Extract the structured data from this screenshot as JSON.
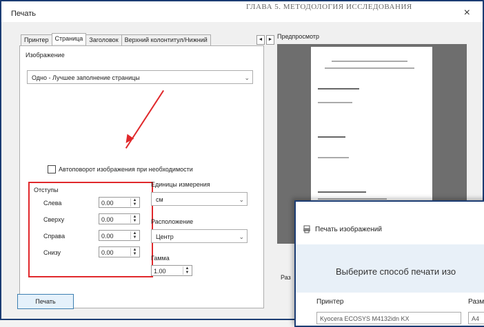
{
  "window": {
    "title": "Печать",
    "close": "×"
  },
  "background_text": "ГЛАВА 5. МЕТОДОЛОГИЯ ИССЛЕДОВАНИЯ",
  "tabs": [
    "Принтер",
    "Страница",
    "Заголовок",
    "Верхний колонтитул/Нижний"
  ],
  "image_section": {
    "label": "Изображение",
    "selected": "Одно - Лучшее заполнение страницы"
  },
  "autorotate": "Автоповорот изображения при необходимости",
  "margins": {
    "label": "Отступы",
    "rows": [
      {
        "label": "Слева",
        "value": "0.00"
      },
      {
        "label": "Сверху",
        "value": "0.00"
      },
      {
        "label": "Справа",
        "value": "0.00"
      },
      {
        "label": "Снизу",
        "value": "0.00"
      }
    ]
  },
  "units": {
    "label": "Единицы измерения",
    "selected": "см"
  },
  "placement": {
    "label": "Расположение",
    "selected": "Центр"
  },
  "gamma": {
    "label": "Гамма",
    "value": "1.00"
  },
  "print_button": "Печать",
  "preview_label": "Предпросмотр",
  "side_bottom_text": "Раз",
  "overlay": {
    "title": "Печать изображений",
    "heading": "Выберите способ печати изо",
    "printer_label": "Принтер",
    "size_label": "Разм",
    "printer_value": "Kyocera ECOSYS M4132idn KX",
    "size_value": "A4"
  },
  "colors": {
    "highlight": "#e0282b",
    "frame": "#1b3c73"
  }
}
